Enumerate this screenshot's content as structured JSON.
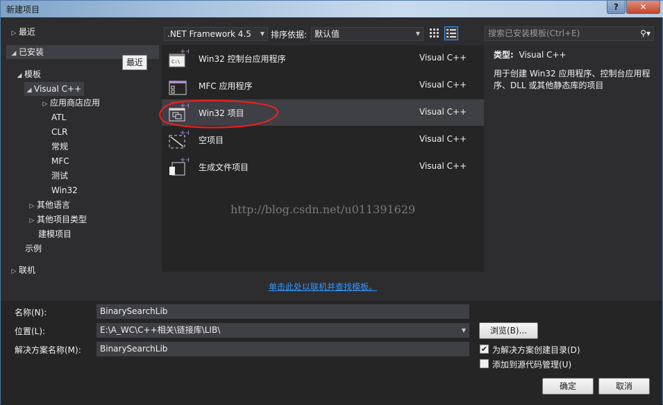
{
  "window": {
    "title": "新建项目",
    "help_glyph": "?",
    "close_glyph": "✕"
  },
  "tooltip": "最近",
  "tree": [
    {
      "label": "最近",
      "arrow": "▷"
    },
    {
      "label": "已安装",
      "arrow": "◢"
    },
    {
      "label": "模板",
      "arrow": "◢"
    },
    {
      "label": "Visual C++",
      "arrow": "◢"
    },
    {
      "label": "应用商店应用",
      "arrow": "▷"
    },
    {
      "label": "ATL",
      "arrow": ""
    },
    {
      "label": "CLR",
      "arrow": ""
    },
    {
      "label": "常规",
      "arrow": ""
    },
    {
      "label": "MFC",
      "arrow": ""
    },
    {
      "label": "测试",
      "arrow": ""
    },
    {
      "label": "Win32",
      "arrow": ""
    },
    {
      "label": "其他语言",
      "arrow": "▷"
    },
    {
      "label": "其他项目类型",
      "arrow": "▷"
    },
    {
      "label": "建模项目",
      "arrow": ""
    },
    {
      "label": "示例",
      "arrow": ""
    },
    {
      "label": "联机",
      "arrow": "▷"
    }
  ],
  "toolbar": {
    "framework": ".NET Framework 4.5",
    "sort_label": "排序依据:",
    "sort_value": "默认值",
    "search_placeholder": "搜索已安装模板(Ctrl+E)",
    "search_icon": "⚲▾"
  },
  "templates": [
    {
      "name": "Win32 控制台应用程序",
      "lang": "Visual C++",
      "icon": "console-app-icon"
    },
    {
      "name": "MFC 应用程序",
      "lang": "Visual C++",
      "icon": "mfc-app-icon"
    },
    {
      "name": "Win32 项目",
      "lang": "Visual C++",
      "icon": "win32-project-icon"
    },
    {
      "name": "空项目",
      "lang": "Visual C++",
      "icon": "empty-project-icon"
    },
    {
      "name": "生成文件项目",
      "lang": "Visual C++",
      "icon": "makefile-project-icon"
    }
  ],
  "watermark": "http://blog.csdn.net/u011391629",
  "description": {
    "type_label": "类型:",
    "type_value": "Visual C++",
    "text": "用于创建 Win32 应用程序、控制台应用程序、DLL 或其他静态库的项目"
  },
  "online_link": "单击此处以联机并查找模板。",
  "form": {
    "name_label": "名称(N):",
    "name_value": "BinarySearchLib",
    "location_label": "位置(L):",
    "location_value": "E:\\A_WC\\C++相关\\链接库\\LIB\\",
    "solution_label": "解决方案名称(M):",
    "solution_value": "BinarySearchLib",
    "browse_label": "浏览(B)...",
    "create_dir_label": "为解决方案创建目录(D)",
    "create_dir_checked": true,
    "source_control_label": "添加到源代码管理(U)",
    "source_control_checked": false,
    "ok_label": "确定",
    "cancel_label": "取消"
  },
  "colors": {
    "accent": "#3399ff",
    "annotation": "#e8201c",
    "panel": "#252526",
    "selected": "#3f3f46"
  }
}
